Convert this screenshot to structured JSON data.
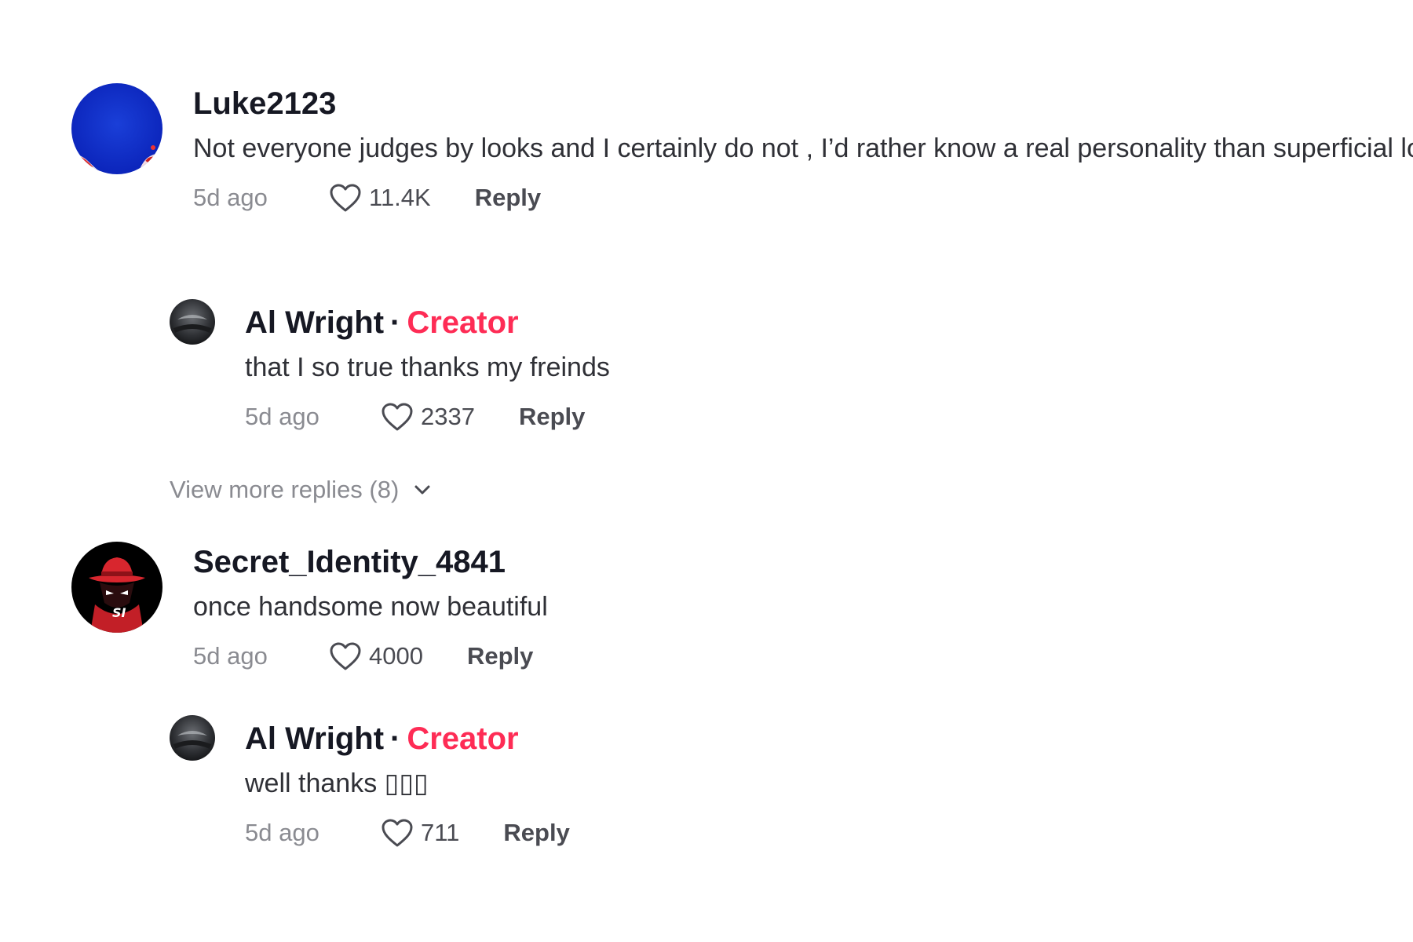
{
  "comments": [
    {
      "username": "Luke2123",
      "text": "Not everyone judges by looks and I certainly do not , I’d rather know a real personality than superficial looks",
      "time": "5d ago",
      "likes": "11.4K",
      "reply_label": "Reply",
      "avatar": "blue-avatar",
      "replies": [
        {
          "username": "Al Wright",
          "separator": "·",
          "badge": "Creator",
          "text": "that I so true thanks my freinds",
          "time": "5d ago",
          "likes": "2337",
          "reply_label": "Reply",
          "avatar": "dark-avatar"
        }
      ],
      "view_more": "View more replies (8)"
    },
    {
      "username": "Secret_Identity_4841",
      "text": "once handsome now beautiful",
      "time": "5d ago",
      "likes": "4000",
      "reply_label": "Reply",
      "avatar": "hooded-figure-avatar",
      "replies": [
        {
          "username": "Al Wright",
          "separator": "·",
          "badge": "Creator",
          "text": "well thanks ▯▯▯",
          "time": "5d ago",
          "likes": "711",
          "reply_label": "Reply",
          "avatar": "dark-avatar"
        }
      ]
    }
  ],
  "icons": {
    "like": "heart-outline-icon",
    "expand": "chevron-down-icon"
  },
  "colors": {
    "creator_badge": "#fe2c55",
    "username": "#161823",
    "muted": "#8a8b91"
  }
}
